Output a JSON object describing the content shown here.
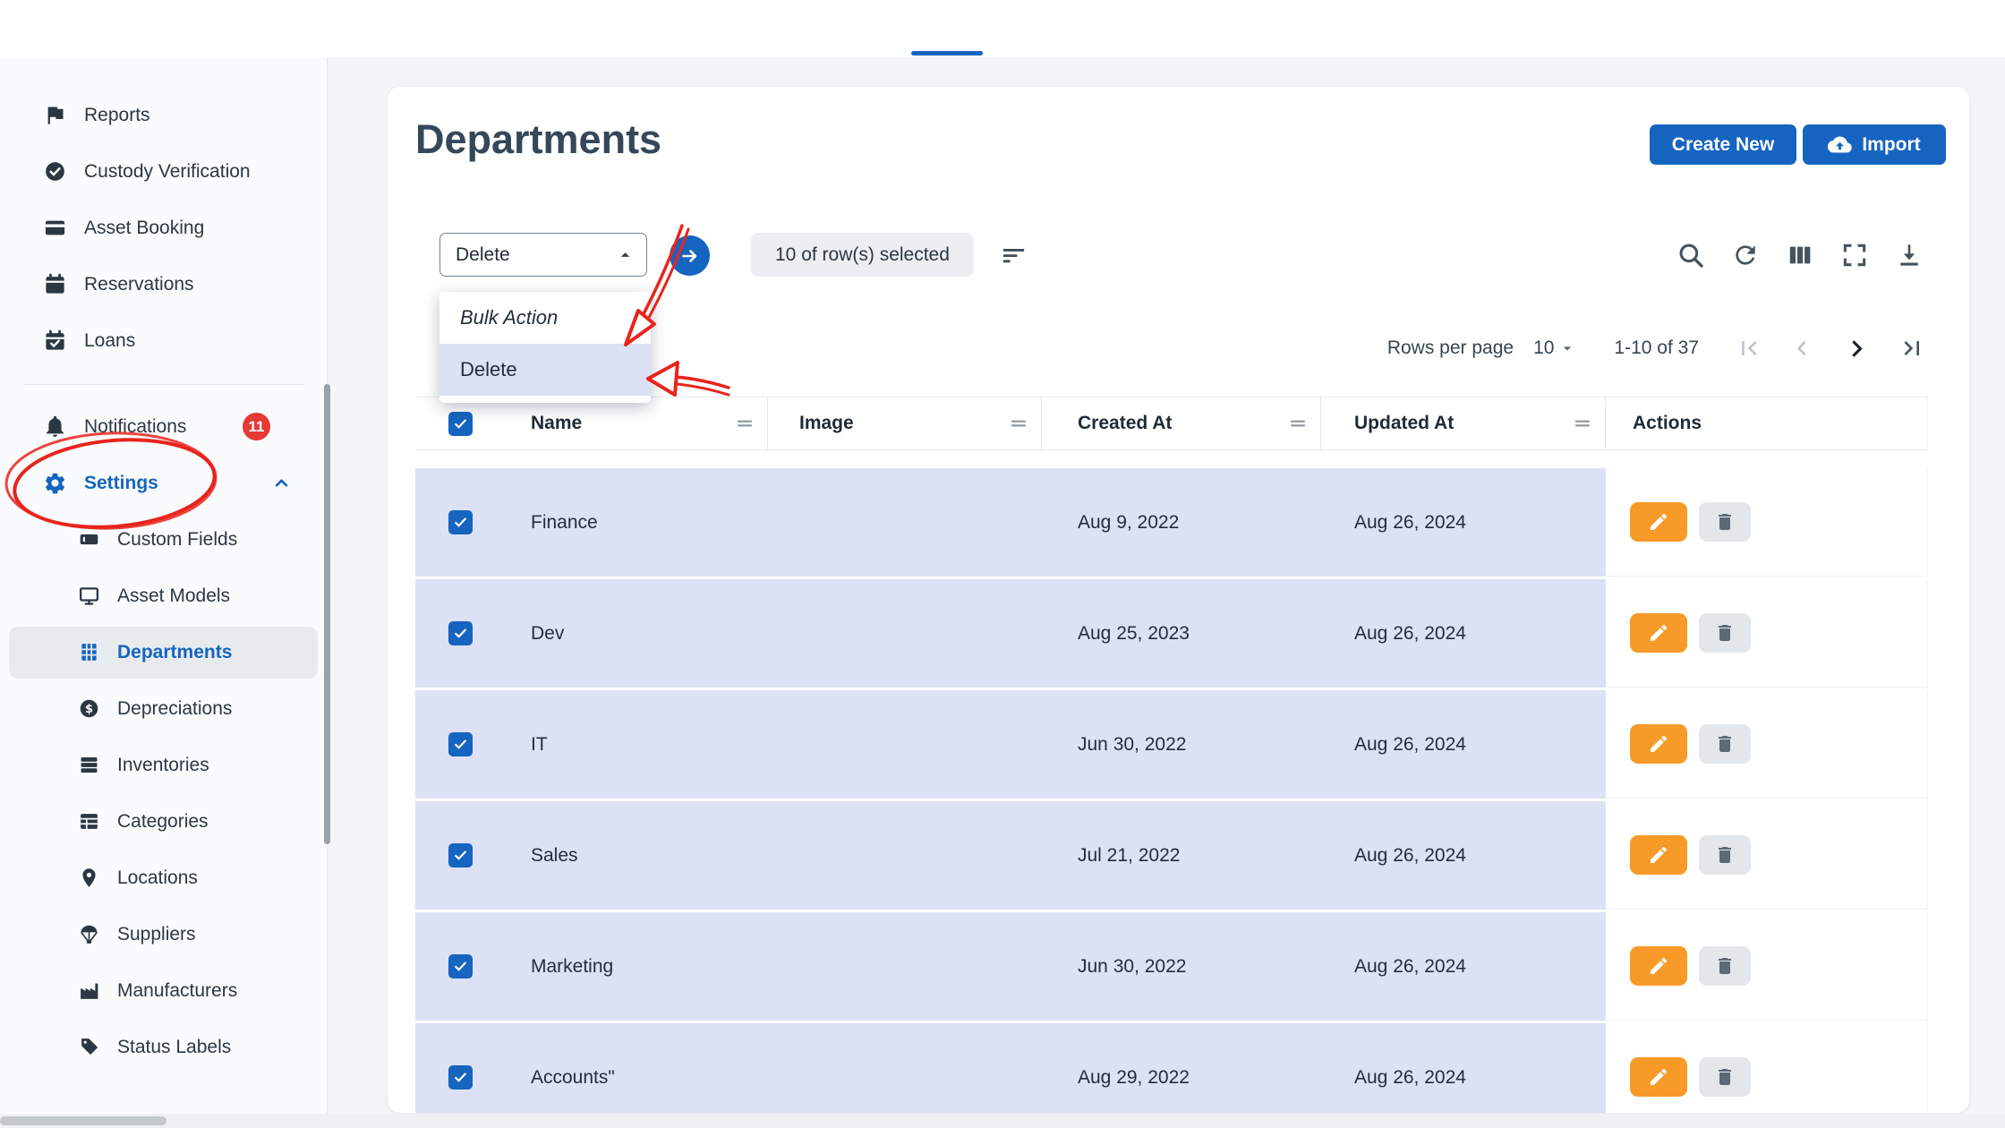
{
  "colors": {
    "primary": "#1565c0",
    "selected_row_bg": "#dce1f6",
    "edit_button_bg": "#f79a28",
    "annotation_red": "#e8251d",
    "badge_red": "#e53935"
  },
  "sidebar": {
    "main_items": [
      {
        "label": "Reports",
        "icon": "flag"
      },
      {
        "label": "Custody Verification",
        "icon": "verified"
      },
      {
        "label": "Asset Booking",
        "icon": "card"
      },
      {
        "label": "Reservations",
        "icon": "calendar"
      },
      {
        "label": "Loans",
        "icon": "calendar-check"
      }
    ],
    "notifications": {
      "label": "Notifications",
      "icon": "bell",
      "badge": "11"
    },
    "settings": {
      "label": "Settings",
      "icon": "gear",
      "expanded": true
    },
    "settings_items": [
      {
        "label": "Custom Fields",
        "icon": "field"
      },
      {
        "label": "Asset Models",
        "icon": "monitor"
      },
      {
        "label": "Departments",
        "icon": "building",
        "active": true
      },
      {
        "label": "Depreciations",
        "icon": "dollar"
      },
      {
        "label": "Inventories",
        "icon": "inventory"
      },
      {
        "label": "Categories",
        "icon": "grid"
      },
      {
        "label": "Locations",
        "icon": "pin"
      },
      {
        "label": "Suppliers",
        "icon": "parachute"
      },
      {
        "label": "Manufacturers",
        "icon": "factory"
      },
      {
        "label": "Status Labels",
        "icon": "tag"
      }
    ]
  },
  "header": {
    "title": "Departments",
    "create_button_label": "Create New",
    "import_button_label": "Import"
  },
  "toolbar": {
    "bulk_select_value": "Delete",
    "selected_chip": "10 of row(s) selected",
    "menu": {
      "header": "Bulk Action",
      "delete_option": "Delete"
    }
  },
  "pagination": {
    "rows_per_page_label": "Rows per page",
    "rows_per_page_value": "10",
    "range_text": "1-10 of 37"
  },
  "table": {
    "columns": [
      "Name",
      "Image",
      "Created At",
      "Updated At",
      "Actions"
    ],
    "rows": [
      {
        "name": "Finance",
        "image": "",
        "created_at": "Aug 9, 2022",
        "updated_at": "Aug 26, 2024",
        "selected": true
      },
      {
        "name": "Dev",
        "image": "",
        "created_at": "Aug 25, 2023",
        "updated_at": "Aug 26, 2024",
        "selected": true
      },
      {
        "name": "IT",
        "image": "",
        "created_at": "Jun 30, 2022",
        "updated_at": "Aug 26, 2024",
        "selected": true
      },
      {
        "name": "Sales",
        "image": "",
        "created_at": "Jul 21, 2022",
        "updated_at": "Aug 26, 2024",
        "selected": true
      },
      {
        "name": "Marketing",
        "image": "",
        "created_at": "Jun 30, 2022",
        "updated_at": "Aug 26, 2024",
        "selected": true
      },
      {
        "name": "Accounts\"",
        "image": "",
        "created_at": "Aug 29, 2022",
        "updated_at": "Aug 26, 2024",
        "selected": true
      }
    ]
  }
}
